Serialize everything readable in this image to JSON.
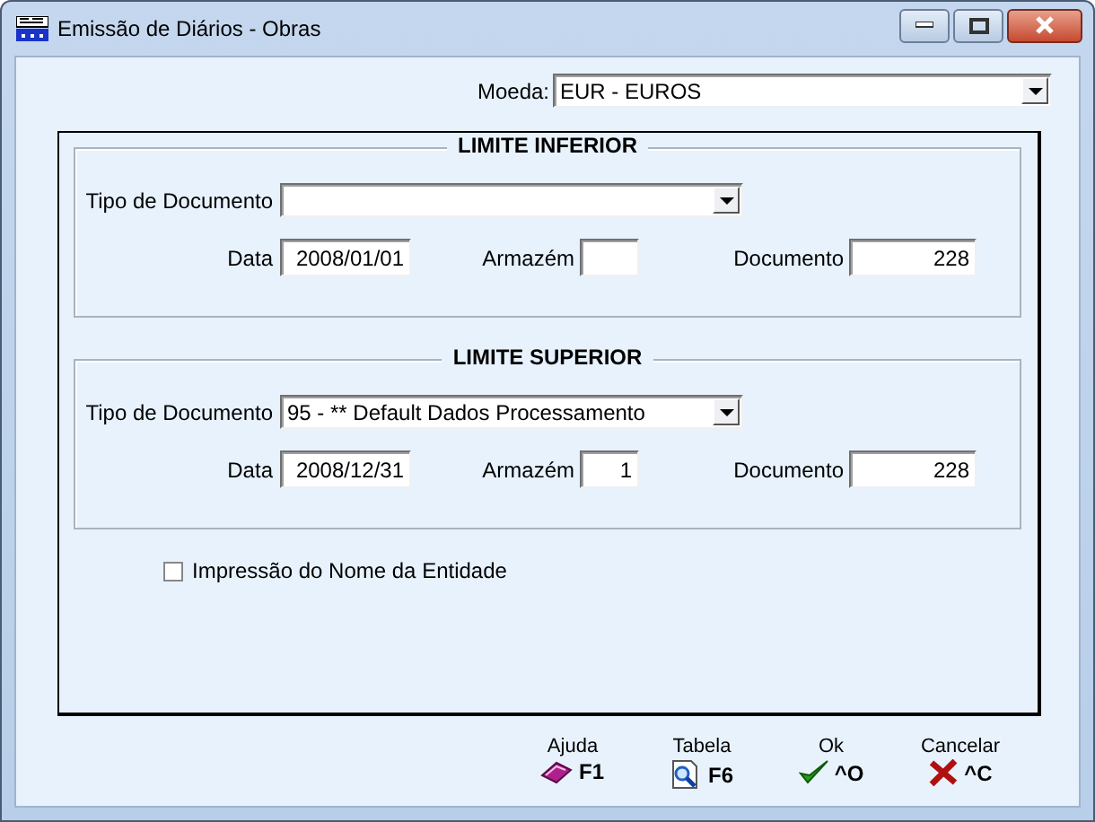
{
  "window": {
    "title": "Emissão de Diários - Obras"
  },
  "currency": {
    "label": "Moeda:",
    "value": "EUR - EUROS"
  },
  "groups": [
    {
      "title": "LIMITE INFERIOR",
      "doc_type": {
        "label": "Tipo de Documento"
      },
      "date": {
        "label": "Data",
        "value": "2008/01/01"
      },
      "warehouse": {
        "label": "Armazém"
      },
      "document": {
        "label": "Documento",
        "value": "228"
      }
    },
    {
      "title": "LIMITE SUPERIOR",
      "doc_type": {
        "label": "Tipo de Documento",
        "value": "95 - ** Default Dados Processamento"
      },
      "date": {
        "label": "Data",
        "value": "2008/12/31"
      },
      "warehouse": {
        "label": "Armazém",
        "value": "1"
      },
      "document": {
        "label": "Documento",
        "value": "228"
      }
    }
  ],
  "print_entity_name": {
    "label": "Impressão do Nome da Entidade",
    "checked": false
  },
  "buttons": [
    {
      "kind": "help",
      "label": "Ajuda",
      "shortcut": "F1"
    },
    {
      "kind": "table",
      "label": "Tabela",
      "shortcut": "F6"
    },
    {
      "kind": "ok",
      "label": "Ok",
      "shortcut": "^O"
    },
    {
      "kind": "cancel",
      "label": "Cancelar",
      "shortcut": "^C"
    }
  ]
}
